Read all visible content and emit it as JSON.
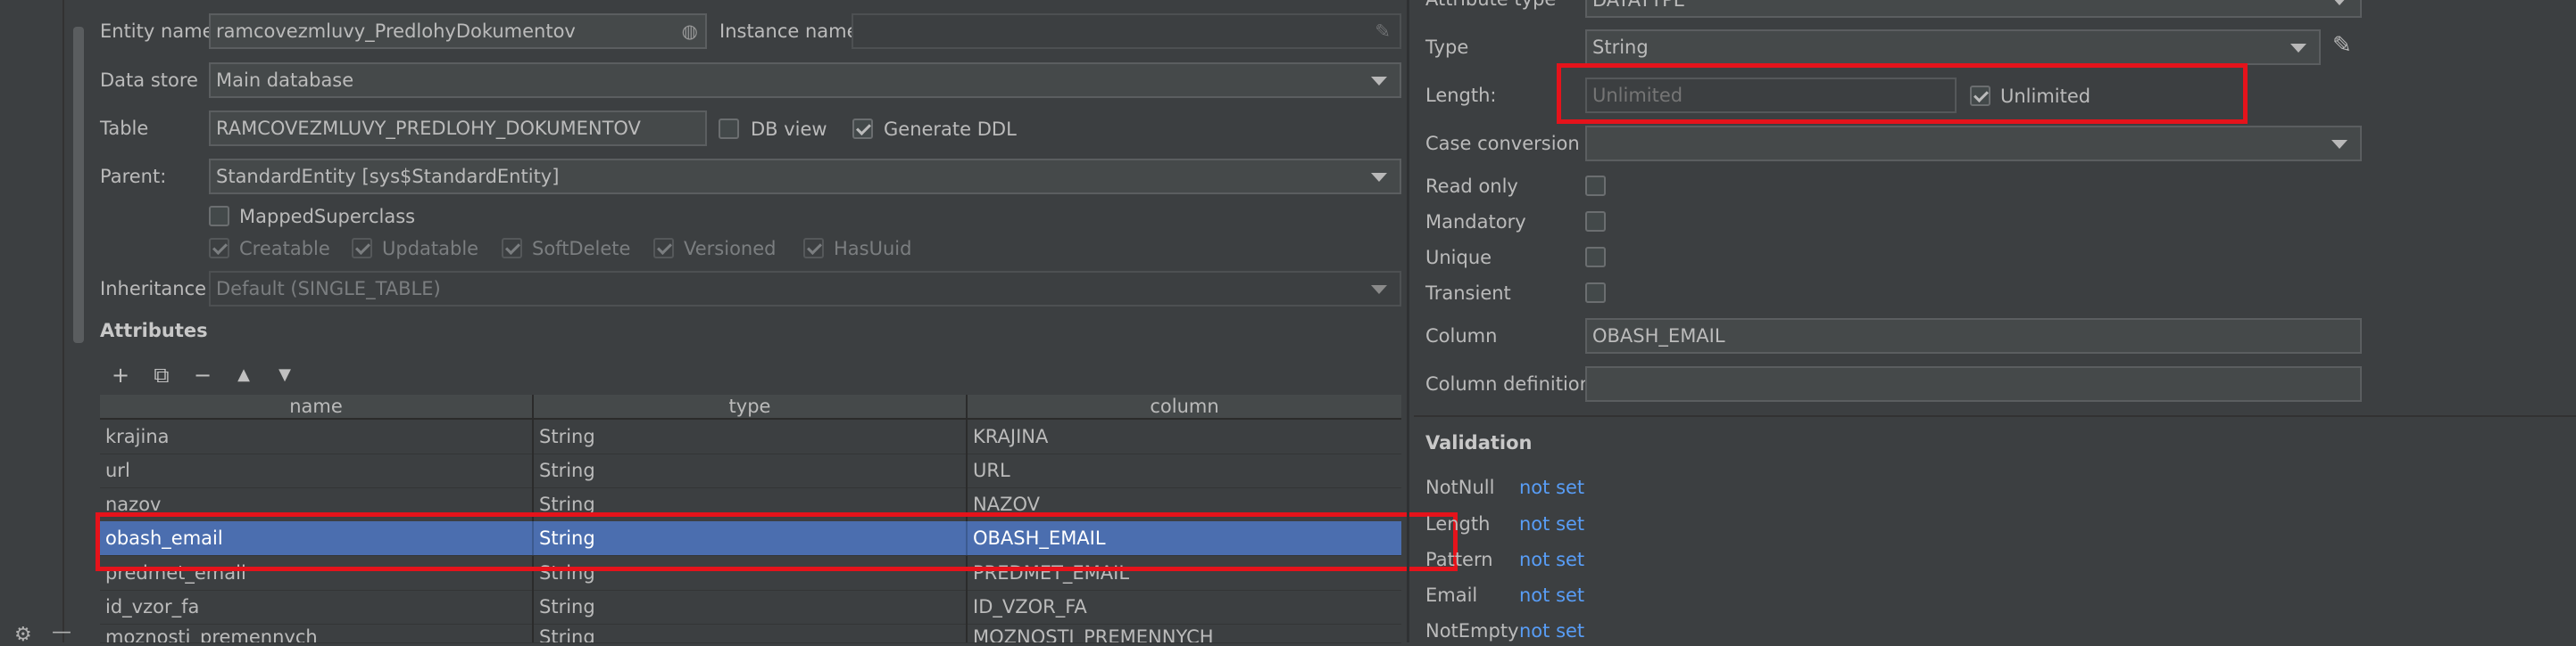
{
  "form": {
    "entity_name_label": "Entity name",
    "entity_name_value": "ramcovezmluvy_PredlohyDokumentov",
    "instance_name_label": "Instance name",
    "data_store_label": "Data store",
    "data_store_value": "Main database",
    "table_label": "Table",
    "table_value": "RAMCOVEZMLUVY_PREDLOHY_DOKUMENTOV",
    "db_view_label": "DB view",
    "generate_ddl_label": "Generate DDL",
    "parent_label": "Parent:",
    "parent_value": "StandardEntity [sys$StandardEntity]",
    "mapped_superclass_label": "MappedSuperclass",
    "traits": [
      "Creatable",
      "Updatable",
      "SoftDelete",
      "Versioned",
      "HasUuid"
    ],
    "inheritance_label": "Inheritance",
    "inheritance_value": "Default (SINGLE_TABLE)"
  },
  "attributes": {
    "title": "Attributes",
    "toolbar": {
      "add": "+",
      "copy": "⧉",
      "remove": "−",
      "up": "▲",
      "down": "▼"
    },
    "headers": [
      "name",
      "type",
      "column"
    ],
    "rows": [
      {
        "name": "krajina",
        "type": "String",
        "column": "KRAJINA"
      },
      {
        "name": "url",
        "type": "String",
        "column": "URL"
      },
      {
        "name": "nazov",
        "type": "String",
        "column": "NAZOV"
      },
      {
        "name": "obash_email",
        "type": "String",
        "column": "OBASH_EMAIL"
      },
      {
        "name": "predmet_email",
        "type": "String",
        "column": "PREDMET_EMAIL"
      },
      {
        "name": "id_vzor_fa",
        "type": "String",
        "column": "ID_VZOR_FA"
      },
      {
        "name": "moznosti_premennych",
        "type": "String",
        "column": "MOZNOSTI_PREMENNYCH"
      }
    ]
  },
  "props": {
    "attr_type_label": "Attribute type",
    "attr_type_value": "DATATYPE",
    "type_label": "Type",
    "type_value": "String",
    "length_label": "Length:",
    "length_placeholder": "Unlimited",
    "unlimited_label": "Unlimited",
    "case_conversion_label": "Case conversion",
    "read_only_label": "Read only",
    "mandatory_label": "Mandatory",
    "unique_label": "Unique",
    "transient_label": "Transient",
    "column_label": "Column",
    "column_value": "OBASH_EMAIL",
    "column_def_label": "Column definition"
  },
  "validation": {
    "title": "Validation",
    "items": [
      {
        "label": "NotNull",
        "value": "not set"
      },
      {
        "label": "Length",
        "value": "not set"
      },
      {
        "label": "Pattern",
        "value": "not set"
      },
      {
        "label": "Email",
        "value": "not set"
      },
      {
        "label": "NotEmpty",
        "value": "not set"
      }
    ]
  }
}
